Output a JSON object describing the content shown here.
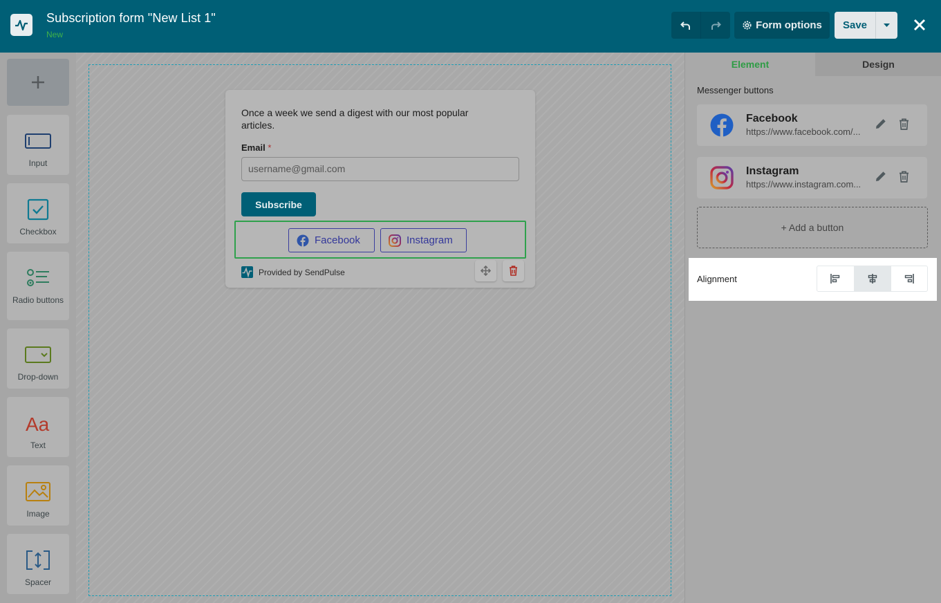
{
  "header": {
    "title": "Subscription form \"New List 1\"",
    "status": "New",
    "form_options_label": "Form options",
    "save_label": "Save"
  },
  "palette": {
    "items": [
      {
        "label": "Input"
      },
      {
        "label": "Checkbox"
      },
      {
        "label": "Radio buttons"
      },
      {
        "label": "Drop-down"
      },
      {
        "label": "Text"
      },
      {
        "label": "Image"
      },
      {
        "label": "Spacer"
      }
    ]
  },
  "form": {
    "description": "Once a week we send a digest with our most popular articles.",
    "email_label": "Email",
    "required_mark": "*",
    "email_placeholder": "username@gmail.com",
    "subscribe_label": "Subscribe",
    "messenger_buttons": [
      {
        "label": "Facebook"
      },
      {
        "label": "Instagram"
      }
    ],
    "provided_by": "Provided by SendPulse"
  },
  "panel": {
    "tabs": [
      {
        "label": "Element",
        "active": true
      },
      {
        "label": "Design",
        "active": false
      }
    ],
    "section_label": "Messenger buttons",
    "buttons": [
      {
        "name": "Facebook",
        "url": "https://www.facebook.com/..."
      },
      {
        "name": "Instagram",
        "url": "https://www.instagram.com..."
      }
    ],
    "add_button_label": "+ Add a button",
    "alignment_label": "Alignment",
    "alignment_selected": "center"
  },
  "colors": {
    "header_bg": "#005f76",
    "accent_green": "#2e9c45",
    "messenger_border": "#3a3d9e",
    "delete_red": "#c0392b"
  }
}
